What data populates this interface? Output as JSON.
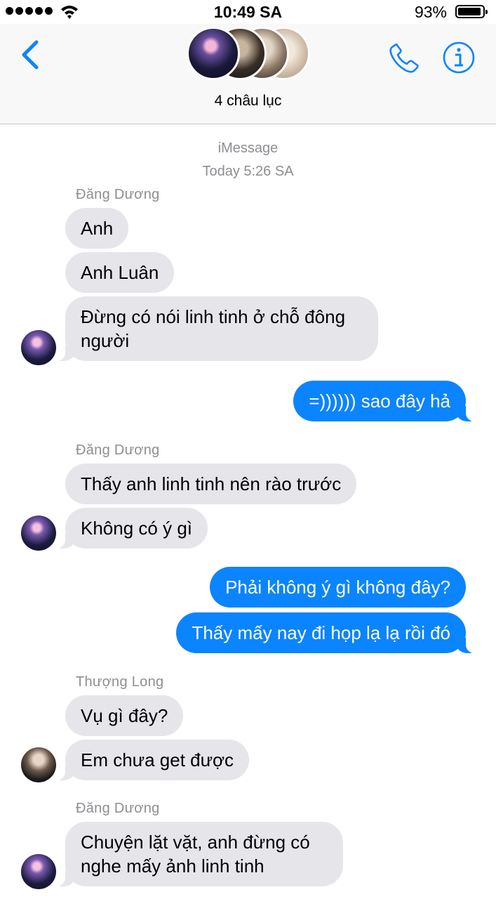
{
  "status_bar": {
    "time": "10:49 SA",
    "battery": "93%",
    "battery_level": 0.93
  },
  "header": {
    "group_name": "4 châu lục"
  },
  "thread": {
    "service": "iMessage",
    "timestamp": "Today 5:26 SA"
  },
  "messages": [
    {
      "sender": "Đăng Dương",
      "text": "Anh"
    },
    {
      "text": "Anh Luân"
    },
    {
      "text": "Đừng có nói linh tinh ở chỗ đông người"
    },
    {
      "text": "=)))))) sao đây hả"
    },
    {
      "sender": "Đăng Dương",
      "text": "Thấy anh linh tinh nên rào trước"
    },
    {
      "text": "Không có ý gì"
    },
    {
      "text": "Phải không ý gì không đây?"
    },
    {
      "text": "Thấy mấy nay đi họp lạ lạ rồi đó"
    },
    {
      "sender": "Thượng Long",
      "text": "Vụ gì đây?"
    },
    {
      "text": "Em chưa get được"
    },
    {
      "sender": "Đăng Dương",
      "text": "Chuyện lặt vặt, anh đừng có nghe mấy ảnh linh tinh"
    }
  ],
  "colors": {
    "accent": "#0b84ff",
    "incoming_bubble": "#e5e5ea",
    "meta_text": "#8e8e93"
  },
  "icons": [
    "back-chevron-icon",
    "phone-icon",
    "info-icon",
    "wifi-icon",
    "battery-icon"
  ]
}
